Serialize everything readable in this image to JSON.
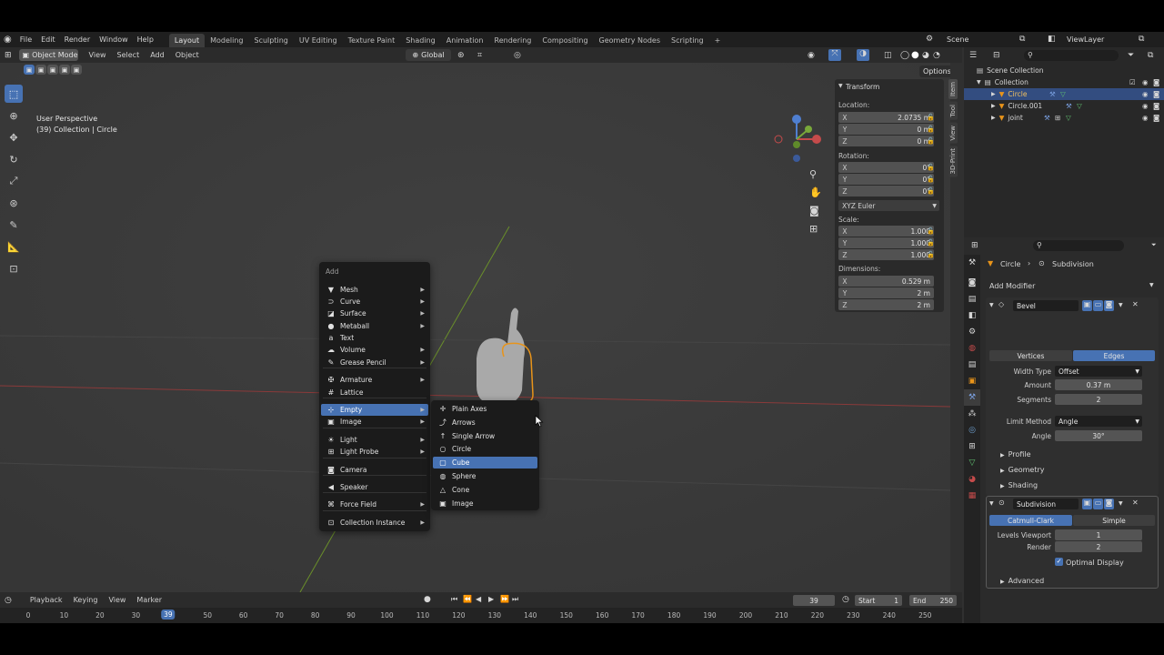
{
  "topbar": {
    "menus": [
      "File",
      "Edit",
      "Render",
      "Window",
      "Help"
    ],
    "workspaces": [
      "Layout",
      "Modeling",
      "Sculpting",
      "UV Editing",
      "Texture Paint",
      "Shading",
      "Animation",
      "Rendering",
      "Compositing",
      "Geometry Nodes",
      "Scripting"
    ],
    "active_workspace": "Layout",
    "add_tab": "+",
    "scene": "Scene",
    "view_layer": "ViewLayer"
  },
  "viewport_header": {
    "mode": "Object Mode",
    "menus": [
      "View",
      "Select",
      "Add",
      "Object"
    ],
    "orientation": "Global",
    "options": "Options"
  },
  "viewport": {
    "perspective": "User Perspective",
    "collection_info": "(39) Collection | Circle"
  },
  "npanel": {
    "header": "Transform",
    "location_label": "Location:",
    "location": [
      {
        "axis": "X",
        "value": "2.0735 m"
      },
      {
        "axis": "Y",
        "value": "0 m"
      },
      {
        "axis": "Z",
        "value": "0 m"
      }
    ],
    "rotation_label": "Rotation:",
    "rotation": [
      {
        "axis": "X",
        "value": "0°"
      },
      {
        "axis": "Y",
        "value": "0°"
      },
      {
        "axis": "Z",
        "value": "0°"
      }
    ],
    "rotation_mode": "XYZ Euler",
    "scale_label": "Scale:",
    "scale": [
      {
        "axis": "X",
        "value": "1.000"
      },
      {
        "axis": "Y",
        "value": "1.000"
      },
      {
        "axis": "Z",
        "value": "1.000"
      }
    ],
    "dimensions_label": "Dimensions:",
    "dimensions": [
      {
        "axis": "X",
        "value": "0.529 m"
      },
      {
        "axis": "Y",
        "value": "2 m"
      },
      {
        "axis": "Z",
        "value": "2 m"
      }
    ],
    "tabs": [
      "Item",
      "Tool",
      "View",
      "3D-Print"
    ]
  },
  "outliner": {
    "rows": [
      {
        "label": "Scene Collection"
      },
      {
        "label": "Collection"
      },
      {
        "label": "Circle"
      },
      {
        "label": "Circle.001"
      },
      {
        "label": "joint"
      }
    ]
  },
  "properties": {
    "breadcrumb_object": "Circle",
    "breadcrumb_modifier": "Subdivision",
    "add_modifier": "Add Modifier",
    "bevel": {
      "name": "Bevel",
      "mode_vertices": "Vertices",
      "mode_edges": "Edges",
      "width_type_label": "Width Type",
      "width_type": "Offset",
      "amount_label": "Amount",
      "amount": "0.37 m",
      "segments_label": "Segments",
      "segments": "2",
      "limit_method_label": "Limit Method",
      "limit_method": "Angle",
      "angle_label": "Angle",
      "angle": "30°",
      "panels": [
        "Profile",
        "Geometry",
        "Shading"
      ]
    },
    "subdivision": {
      "name": "Subdivision",
      "catmull": "Catmull-Clark",
      "simple": "Simple",
      "levels_viewport_label": "Levels Viewport",
      "levels_viewport": "1",
      "render_label": "Render",
      "render": "2",
      "optimal_display": "Optimal Display",
      "advanced": "Advanced"
    }
  },
  "timeline": {
    "menus": [
      "Playback",
      "Keying",
      "View",
      "Marker"
    ],
    "current_frame": "39",
    "start_label": "Start",
    "start": "1",
    "end_label": "End",
    "end": "250",
    "ticks": [
      "0",
      "10",
      "20",
      "30",
      "39",
      "50",
      "60",
      "70",
      "80",
      "90",
      "100",
      "110",
      "120",
      "130",
      "140",
      "150",
      "160",
      "170",
      "180",
      "190",
      "200",
      "210",
      "220",
      "230",
      "240",
      "250"
    ]
  },
  "add_menu": {
    "title": "Add",
    "items": [
      {
        "label": "Mesh",
        "icon": "▼",
        "sub": true
      },
      {
        "label": "Curve",
        "icon": "⊃",
        "sub": true
      },
      {
        "label": "Surface",
        "icon": "◪",
        "sub": true
      },
      {
        "label": "Metaball",
        "icon": "●",
        "sub": true
      },
      {
        "label": "Text",
        "icon": "a",
        "sub": false
      },
      {
        "label": "Volume",
        "icon": "☁",
        "sub": true
      },
      {
        "label": "Grease Pencil",
        "icon": "✎",
        "sub": true
      },
      {
        "label": "Armature",
        "icon": "✠",
        "sub": true
      },
      {
        "label": "Lattice",
        "icon": "#",
        "sub": false
      },
      {
        "label": "Empty",
        "icon": "⊹",
        "sub": true
      },
      {
        "label": "Image",
        "icon": "▣",
        "sub": true
      },
      {
        "label": "Light",
        "icon": "☀",
        "sub": true
      },
      {
        "label": "Light Probe",
        "icon": "⊞",
        "sub": true
      },
      {
        "label": "Camera",
        "icon": "◙",
        "sub": false
      },
      {
        "label": "Speaker",
        "icon": "◀",
        "sub": false
      },
      {
        "label": "Force Field",
        "icon": "⌘",
        "sub": true
      },
      {
        "label": "Collection Instance",
        "icon": "⊡",
        "sub": true
      }
    ],
    "highlighted": "Empty"
  },
  "empty_submenu": {
    "items": [
      {
        "label": "Plain Axes",
        "icon": "✛"
      },
      {
        "label": "Arrows",
        "icon": "⤴"
      },
      {
        "label": "Single Arrow",
        "icon": "↑"
      },
      {
        "label": "Circle",
        "icon": "○"
      },
      {
        "label": "Cube",
        "icon": "▢"
      },
      {
        "label": "Sphere",
        "icon": "◍"
      },
      {
        "label": "Cone",
        "icon": "△"
      },
      {
        "label": "Image",
        "icon": "▣"
      }
    ],
    "highlighted": "Cube"
  },
  "colors": {
    "accent": "#4772b3",
    "selection_outline": "#e8941a",
    "x_axis": "#9a3b3b",
    "y_axis": "#6f9a2a"
  }
}
